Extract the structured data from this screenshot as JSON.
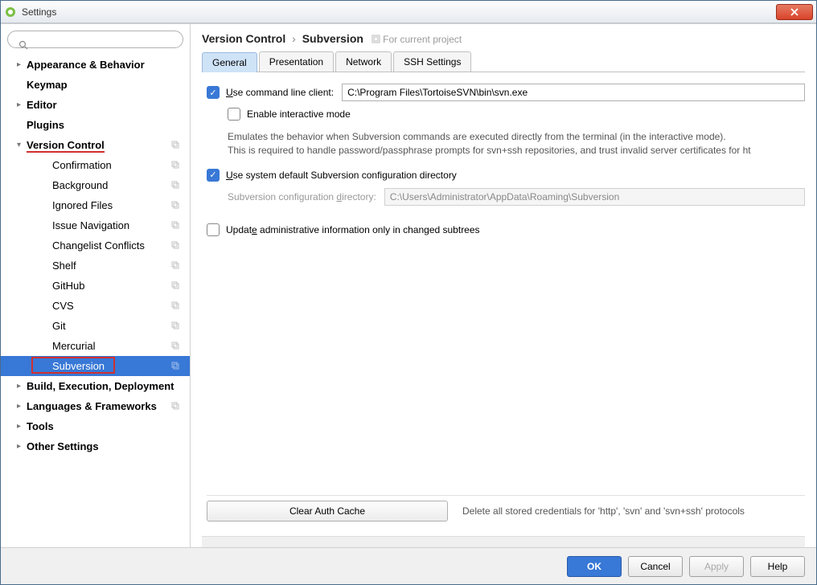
{
  "window": {
    "title": "Settings"
  },
  "search": {
    "placeholder": ""
  },
  "tree": {
    "items": [
      {
        "label": "Appearance & Behavior",
        "bold": true,
        "arrow": "▸",
        "copy": false
      },
      {
        "label": "Keymap",
        "bold": true,
        "arrow": "",
        "copy": false
      },
      {
        "label": "Editor",
        "bold": true,
        "arrow": "▸",
        "copy": false
      },
      {
        "label": "Plugins",
        "bold": true,
        "arrow": "",
        "copy": false
      },
      {
        "label": "Version Control",
        "bold": true,
        "arrow": "▾",
        "copy": true,
        "redline": true
      },
      {
        "label": "Confirmation",
        "child": true,
        "copy": true
      },
      {
        "label": "Background",
        "child": true,
        "copy": true
      },
      {
        "label": "Ignored Files",
        "child": true,
        "copy": true
      },
      {
        "label": "Issue Navigation",
        "child": true,
        "copy": true
      },
      {
        "label": "Changelist Conflicts",
        "child": true,
        "copy": true
      },
      {
        "label": "Shelf",
        "child": true,
        "copy": true
      },
      {
        "label": "GitHub",
        "child": true,
        "copy": true
      },
      {
        "label": "CVS",
        "child": true,
        "copy": true
      },
      {
        "label": "Git",
        "child": true,
        "copy": true
      },
      {
        "label": "Mercurial",
        "child": true,
        "copy": true
      },
      {
        "label": "Subversion",
        "child": true,
        "copy": true,
        "selected": true,
        "redbox": true
      },
      {
        "label": "Build, Execution, Deployment",
        "bold": true,
        "arrow": "▸",
        "copy": false
      },
      {
        "label": "Languages & Frameworks",
        "bold": true,
        "arrow": "▸",
        "copy": true
      },
      {
        "label": "Tools",
        "bold": true,
        "arrow": "▸",
        "copy": false
      },
      {
        "label": "Other Settings",
        "bold": true,
        "arrow": "▸",
        "copy": false
      }
    ]
  },
  "breadcrumb": {
    "part1": "Version Control",
    "part2": "Subversion",
    "hint": "For current project"
  },
  "tabs": [
    "General",
    "Presentation",
    "Network",
    "SSH Settings"
  ],
  "activeTab": 0,
  "form": {
    "useCli": {
      "label_pre": "U",
      "label_post": "se command line client:",
      "checked": true,
      "value": "C:\\Program Files\\TortoiseSVN\\bin\\svn.exe"
    },
    "enableInteractive": {
      "label": "Enable interactive mode",
      "checked": false
    },
    "desc": "Emulates the behavior when Subversion commands are executed directly from the terminal (in the interactive mode).\nThis is required to handle password/passphrase prompts for svn+ssh repositories, and trust invalid server certificates for ht",
    "useDefaultDir": {
      "label_pre": "U",
      "label_post": "se system default Subversion configuration directory",
      "checked": true
    },
    "dirLabel_pre": "Subversion configuration ",
    "dirLabel_u": "d",
    "dirLabel_post": "irectory:",
    "dirValue": "C:\\Users\\Administrator\\AppData\\Roaming\\Subversion",
    "updateAdmin": {
      "label_pre": "Updat",
      "label_u": "e",
      "label_post": " administrative information only in changed subtrees",
      "checked": false
    },
    "clearBtn": "Clear Auth Cache",
    "clearHint": "Delete all stored credentials for 'http', 'svn' and 'svn+ssh' protocols"
  },
  "footer": {
    "ok": "OK",
    "cancel": "Cancel",
    "apply": "Apply",
    "help": "Help"
  }
}
